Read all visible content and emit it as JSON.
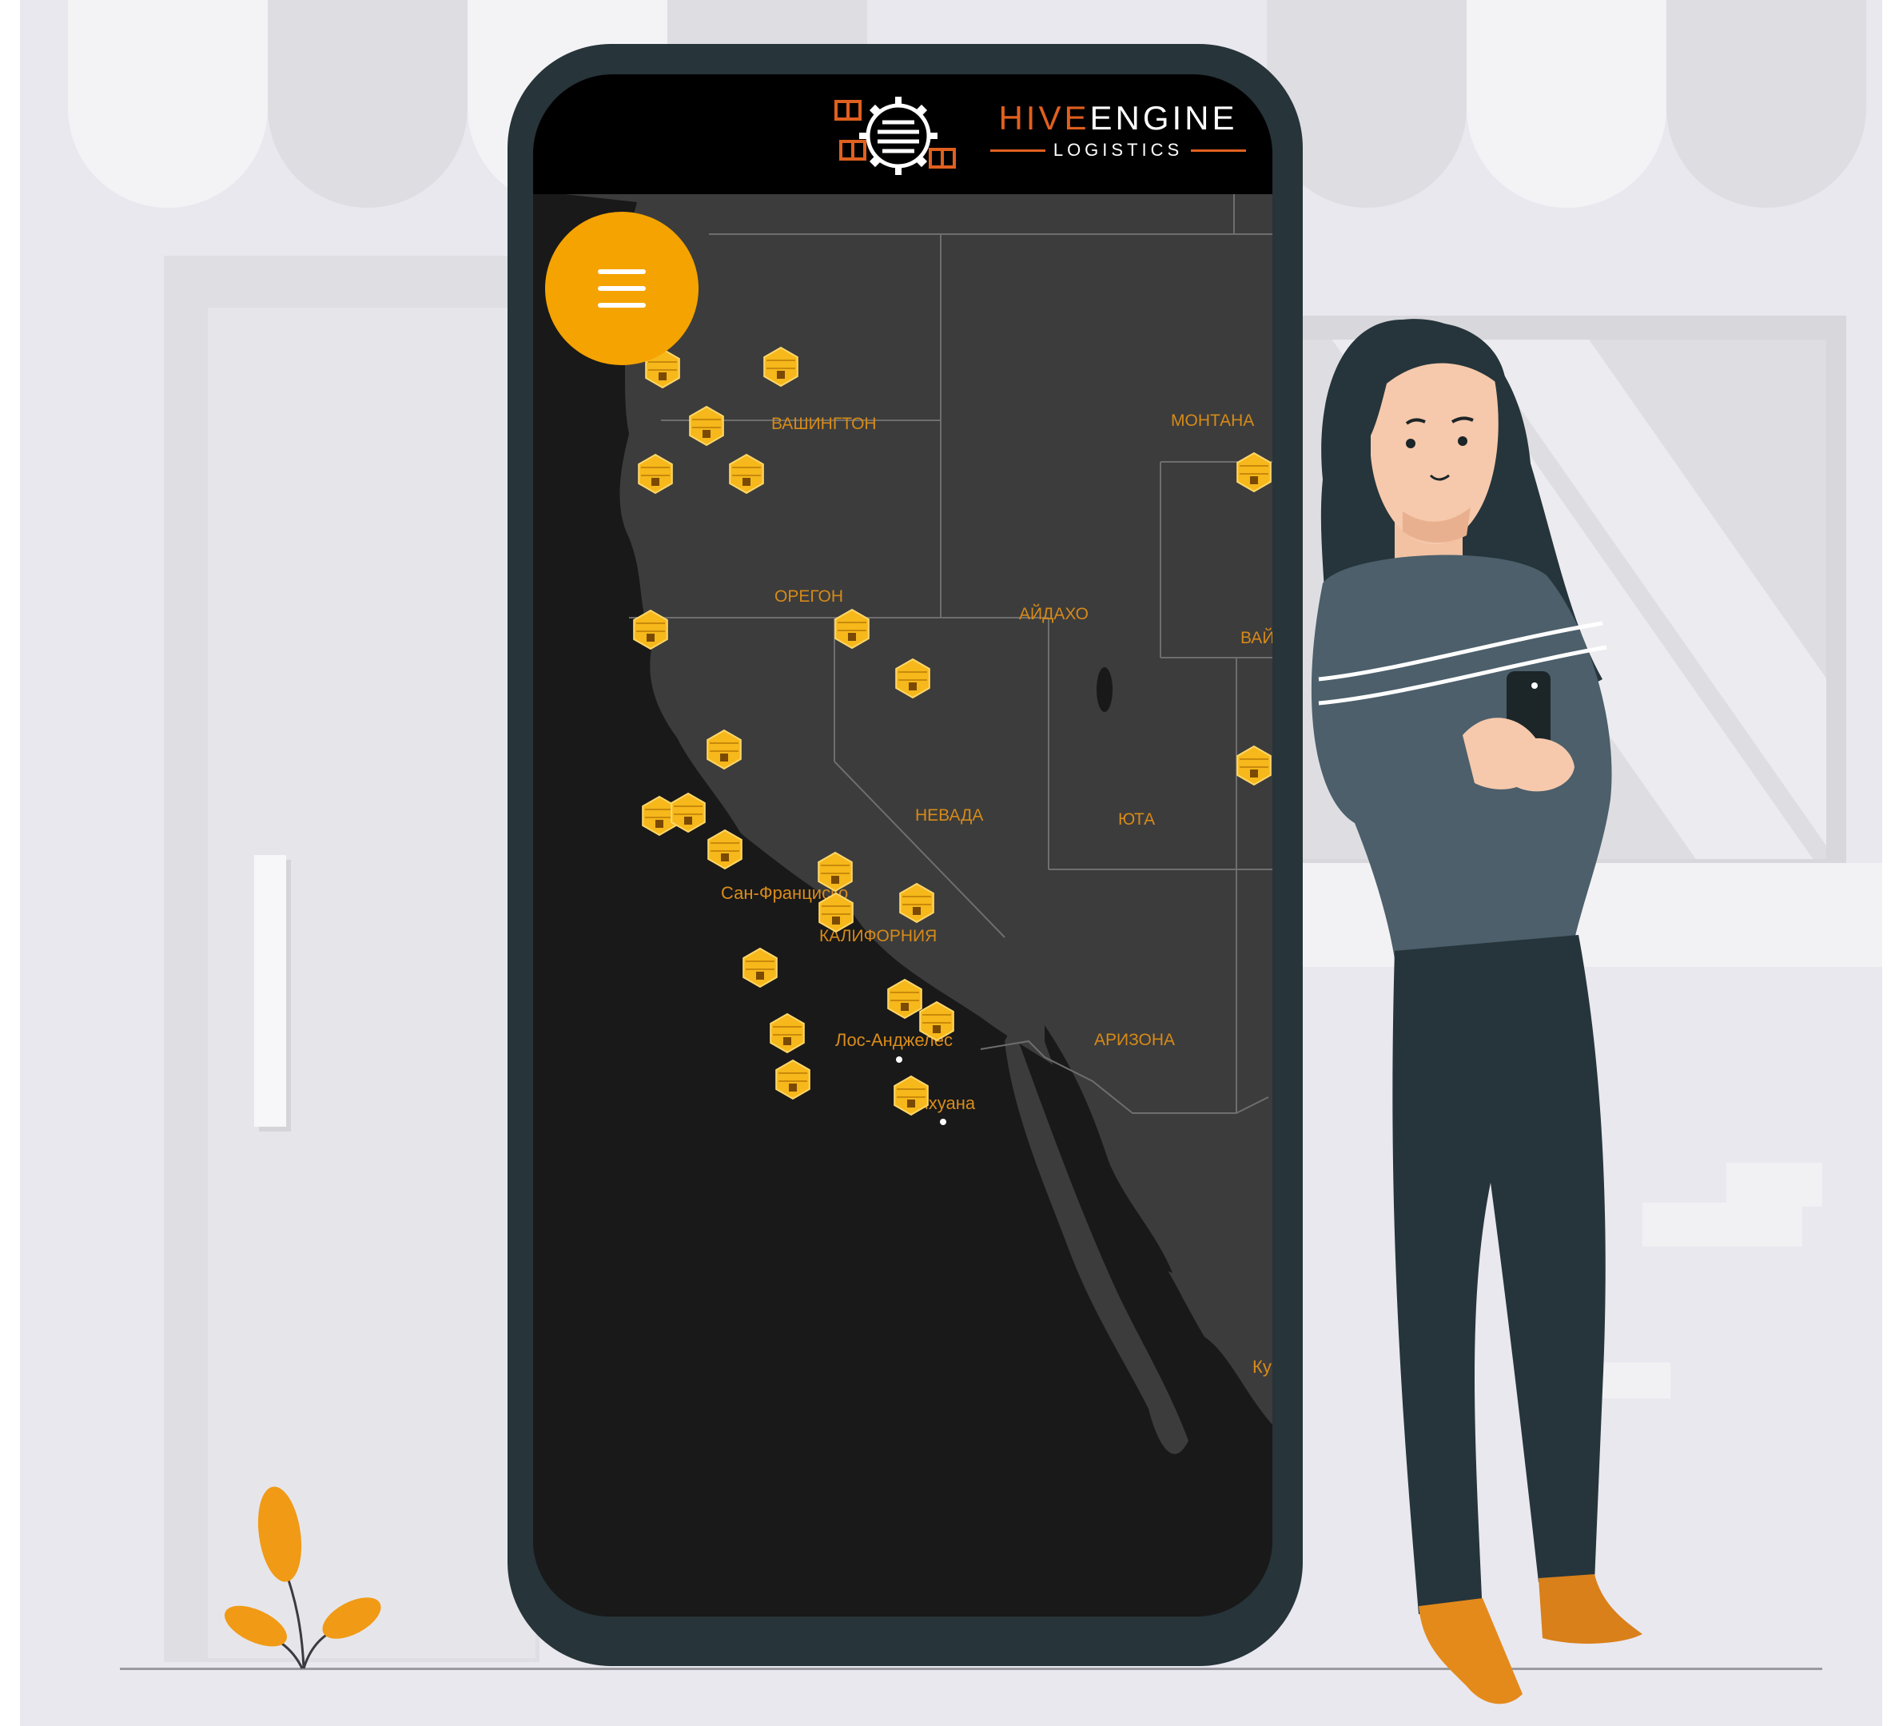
{
  "app": {
    "brand_prefix": "HIVE",
    "brand_suffix": "ENGINE",
    "brand_subtitle": "LOGISTICS",
    "accent_color": "#f5a300",
    "brand_color": "#e0601f"
  },
  "header": {
    "logo_icon": "beehive-gear-with-parcels-icon"
  },
  "menu_button": {
    "icon": "hamburger-menu-icon",
    "color": "#f5a300"
  },
  "map": {
    "theme": "dark",
    "regions": [
      {
        "id": "washington",
        "label": "ВАШИНГТОН"
      },
      {
        "id": "montana",
        "label": "МОНТАНА"
      },
      {
        "id": "oregon",
        "label": "ОРЕГОН"
      },
      {
        "id": "idaho",
        "label": "АЙДАХО"
      },
      {
        "id": "wyoming",
        "label": "ВАЙ"
      },
      {
        "id": "nevada",
        "label": "НЕВАДА"
      },
      {
        "id": "utah",
        "label": "ЮТА"
      },
      {
        "id": "california",
        "label": "КАЛИФОРНИЯ"
      },
      {
        "id": "arizona",
        "label": "АРИЗОНА"
      }
    ],
    "cities": [
      {
        "id": "sf",
        "label": "Сан-Франциско"
      },
      {
        "id": "la",
        "label": "Лос-Анджелес"
      },
      {
        "id": "tijuana",
        "label": "Тихуана"
      },
      {
        "id": "ku",
        "label": "Ку"
      }
    ],
    "marker_icon": "beehive-location-marker-icon",
    "marker_count": 24
  }
}
